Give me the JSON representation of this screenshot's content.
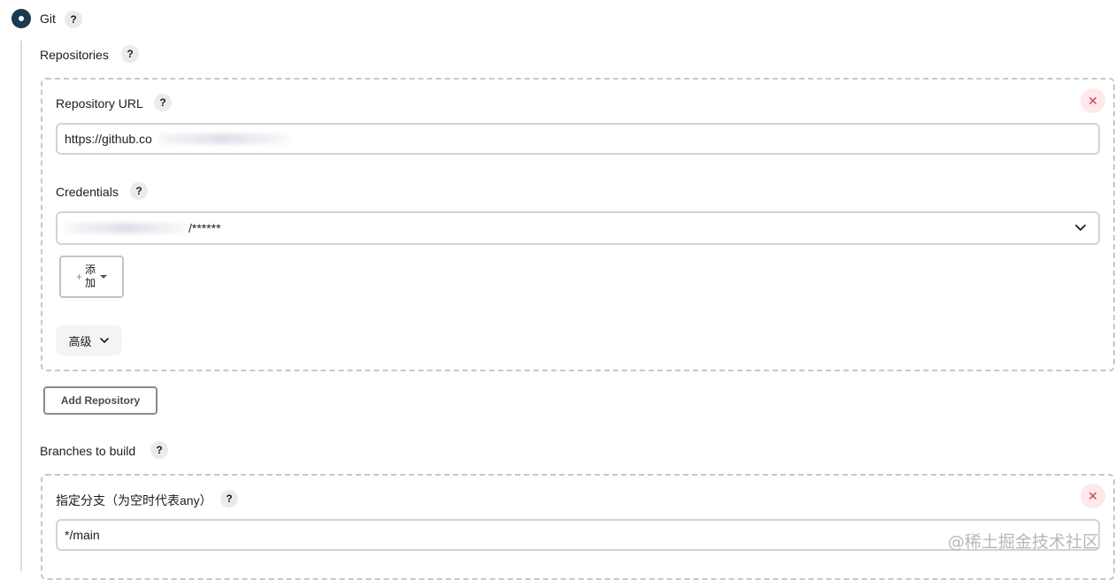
{
  "scm": {
    "label": "Git",
    "help": "?"
  },
  "repositories": {
    "label": "Repositories",
    "help": "?",
    "url_label": "Repository URL",
    "url_help": "?",
    "url_value": "https://github.co",
    "remove": "✕",
    "credentials_label": "Credentials",
    "credentials_help": "?",
    "credentials_value": "/******",
    "add_button_line1": "添",
    "add_button_line2": "加",
    "add_plus": "+",
    "advanced_label": "高级",
    "add_repository": "Add Repository"
  },
  "branches": {
    "label": "Branches to build",
    "help": "?",
    "specifier_label": "指定分支（为空时代表any）",
    "specifier_help": "?",
    "specifier_value": "*/main",
    "remove": "✕"
  },
  "watermark": "@稀土掘金技术社区",
  "colors": {
    "radio": "#1b3a4f",
    "remove_bg": "#fde8ea",
    "remove_fg": "#d33d4f"
  },
  "icons": {
    "radio": "radio-selected-icon",
    "help": "question-icon",
    "remove": "close-icon",
    "dropdown": "chevron-down-icon",
    "add_caret": "caret-down-icon"
  }
}
